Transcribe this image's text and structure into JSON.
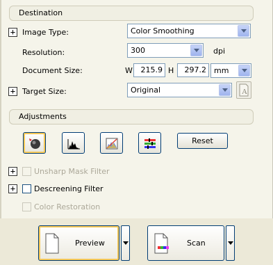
{
  "destination": {
    "header": "Destination",
    "image_type": {
      "label": "Image Type:",
      "value": "Color Smoothing"
    },
    "resolution": {
      "label": "Resolution:",
      "value": "300",
      "unit": "dpi"
    },
    "document_size": {
      "label": "Document Size:",
      "w_label": "W",
      "w_value": "215.9",
      "h_label": "H",
      "h_value": "297.2",
      "unit": "mm"
    },
    "target_size": {
      "label": "Target Size:",
      "value": "Original"
    }
  },
  "adjustments": {
    "header": "Adjustments",
    "reset_label": "Reset",
    "unsharp_mask": {
      "label": "Unsharp Mask Filter",
      "checked": false,
      "enabled": false
    },
    "descreening": {
      "label": "Descreening Filter",
      "checked": false,
      "enabled": true
    },
    "color_restoration": {
      "label": "Color Restoration",
      "checked": false,
      "enabled": false
    }
  },
  "actions": {
    "preview_label": "Preview",
    "scan_label": "Scan"
  },
  "icons": {
    "auto_exposure": "auto-exposure-icon",
    "histogram": "histogram-icon",
    "tone_correction": "tone-correction-icon",
    "image_adjustment": "image-adjustment-icon",
    "text_enhance": "text-enhance-icon"
  }
}
